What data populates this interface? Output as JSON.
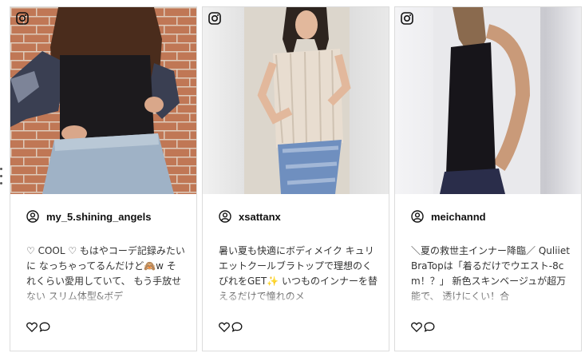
{
  "posts": [
    {
      "username": "my_5.shining_angels",
      "caption": "♡ COOL ♡ もはやコーデ記録みたいに なっちゃってるんだけど🙈w それくらい愛用していて、 もう手放せない スリム体型&ボデ"
    },
    {
      "username": "xsattanx",
      "caption": "暑い夏も快適にボディメイク キュリエットクールブラトップで理想のくびれをGET✨ いつものインナーを替えるだけで憧れのメ"
    },
    {
      "username": "meichannd",
      "caption": "＼夏の救世主インナー降臨／ QuliietBraTopは「着るだけでウエスト-8cm！？」 新色スキンベージュが超万能で、 透けにくい！合"
    }
  ],
  "icons": {
    "platform": "instagram-icon",
    "user": "user-circle-icon",
    "like": "heart-icon",
    "comment": "comment-icon"
  },
  "colors": {
    "border": "#dcdcdc",
    "text": "#333333",
    "username": "#111111"
  }
}
